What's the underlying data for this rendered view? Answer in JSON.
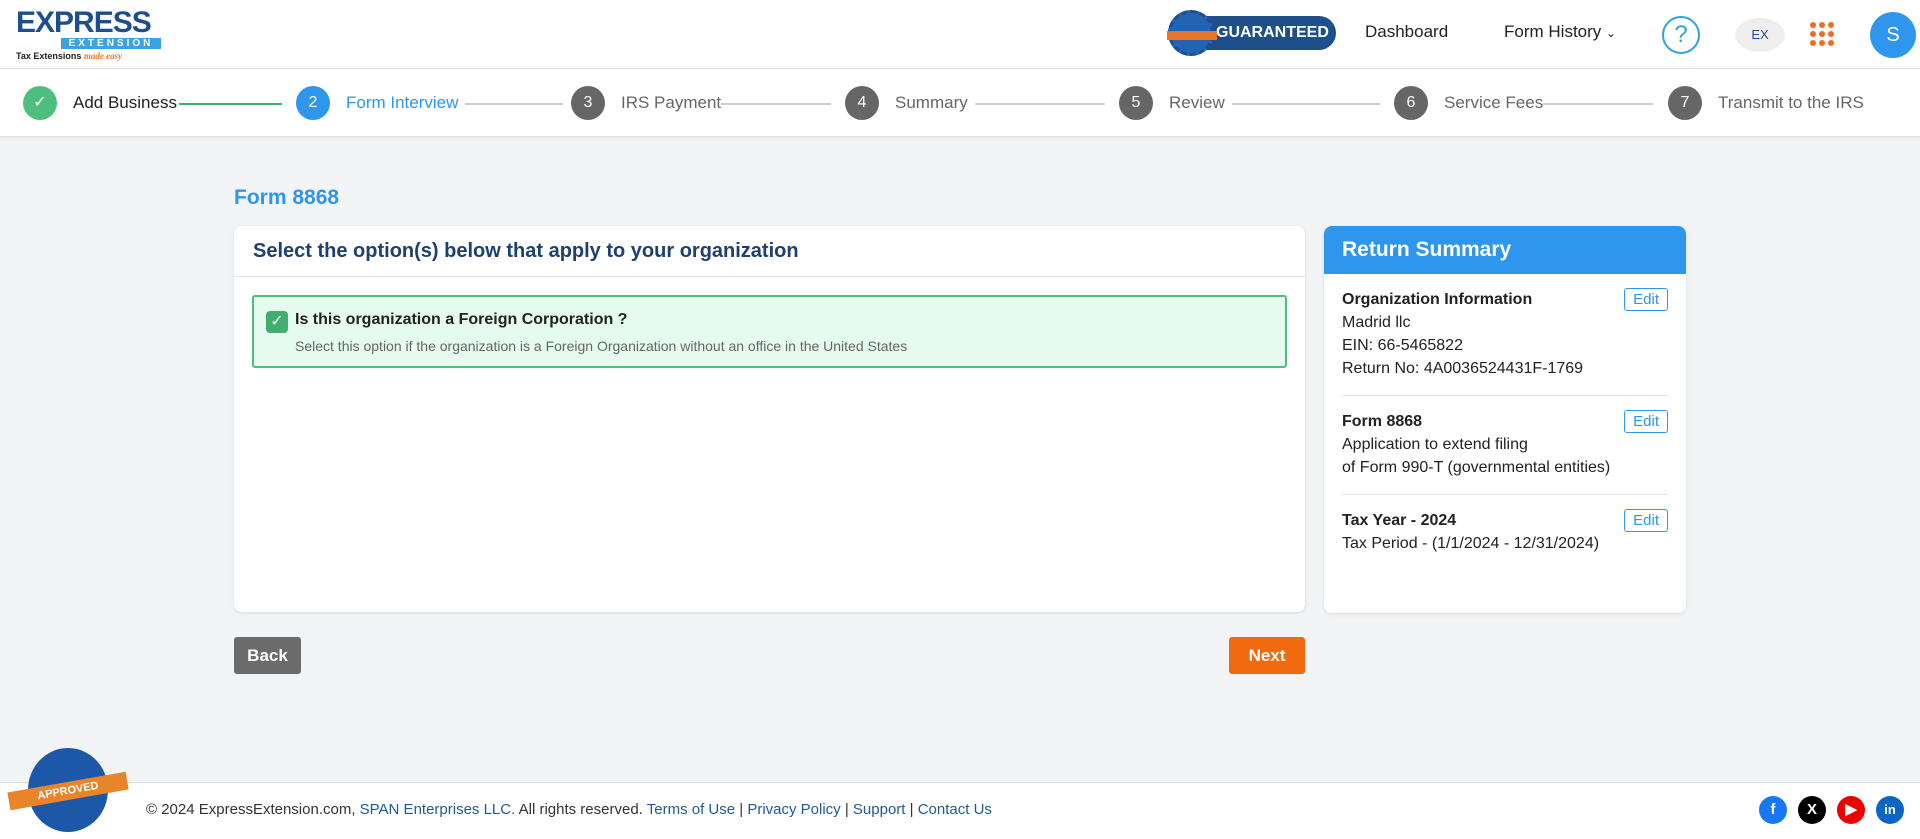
{
  "header": {
    "logo": "EXPRESS EXTENSION",
    "logo_tagline": "Tax Extensions made easy",
    "guaranteed": "GUARANTEED",
    "dashboard": "Dashboard",
    "form_history": "Form History",
    "help": "?",
    "ex": "EX",
    "avatar": "S"
  },
  "steps": [
    {
      "num": "✓",
      "label": "Add Business",
      "state": "done"
    },
    {
      "num": "2",
      "label": "Form Interview",
      "state": "active"
    },
    {
      "num": "3",
      "label": "IRS Payment",
      "state": "pending"
    },
    {
      "num": "4",
      "label": "Summary",
      "state": "pending"
    },
    {
      "num": "5",
      "label": "Review",
      "state": "pending"
    },
    {
      "num": "6",
      "label": "Service Fees",
      "state": "pending"
    },
    {
      "num": "7",
      "label": "Transmit to the IRS",
      "state": "pending"
    }
  ],
  "page_title": "Form 8868",
  "main": {
    "heading": "Select the option(s) below that apply to your organization",
    "option": {
      "checked": true,
      "question": "Is this organization a Foreign Corporation ?",
      "description": "Select this option if the organization is a Foreign Organization without an office in the United States"
    }
  },
  "summary": {
    "title": "Return Summary",
    "edit": "Edit",
    "org": {
      "title": "Organization Information",
      "name": "Madrid llc",
      "ein": "EIN: 66-5465822",
      "return_no": "Return No: 4A0036524431F-1769"
    },
    "form": {
      "title": "Form 8868",
      "line1": "Application to extend filing",
      "line2": "of Form 990-T (governmental entities)"
    },
    "tax": {
      "title": "Tax Year - 2024",
      "period": "Tax Period - (1/1/2024 - 12/31/2024)"
    }
  },
  "buttons": {
    "back": "Back",
    "next": "Next"
  },
  "footer": {
    "copyright": "© 2024 ExpressExtension.com, ",
    "span": "SPAN Enterprises LLC.",
    "rights": " All rights reserved. ",
    "terms": "Terms of Use",
    "privacy": "Privacy Policy",
    "support": "Support",
    "contact": "Contact Us",
    "sep": " | ",
    "badge": "APPROVED"
  },
  "colors": {
    "primary": "#2f96ee",
    "success": "#4cbf7d",
    "next": "#f26a0f",
    "back": "#6b6b6b"
  }
}
